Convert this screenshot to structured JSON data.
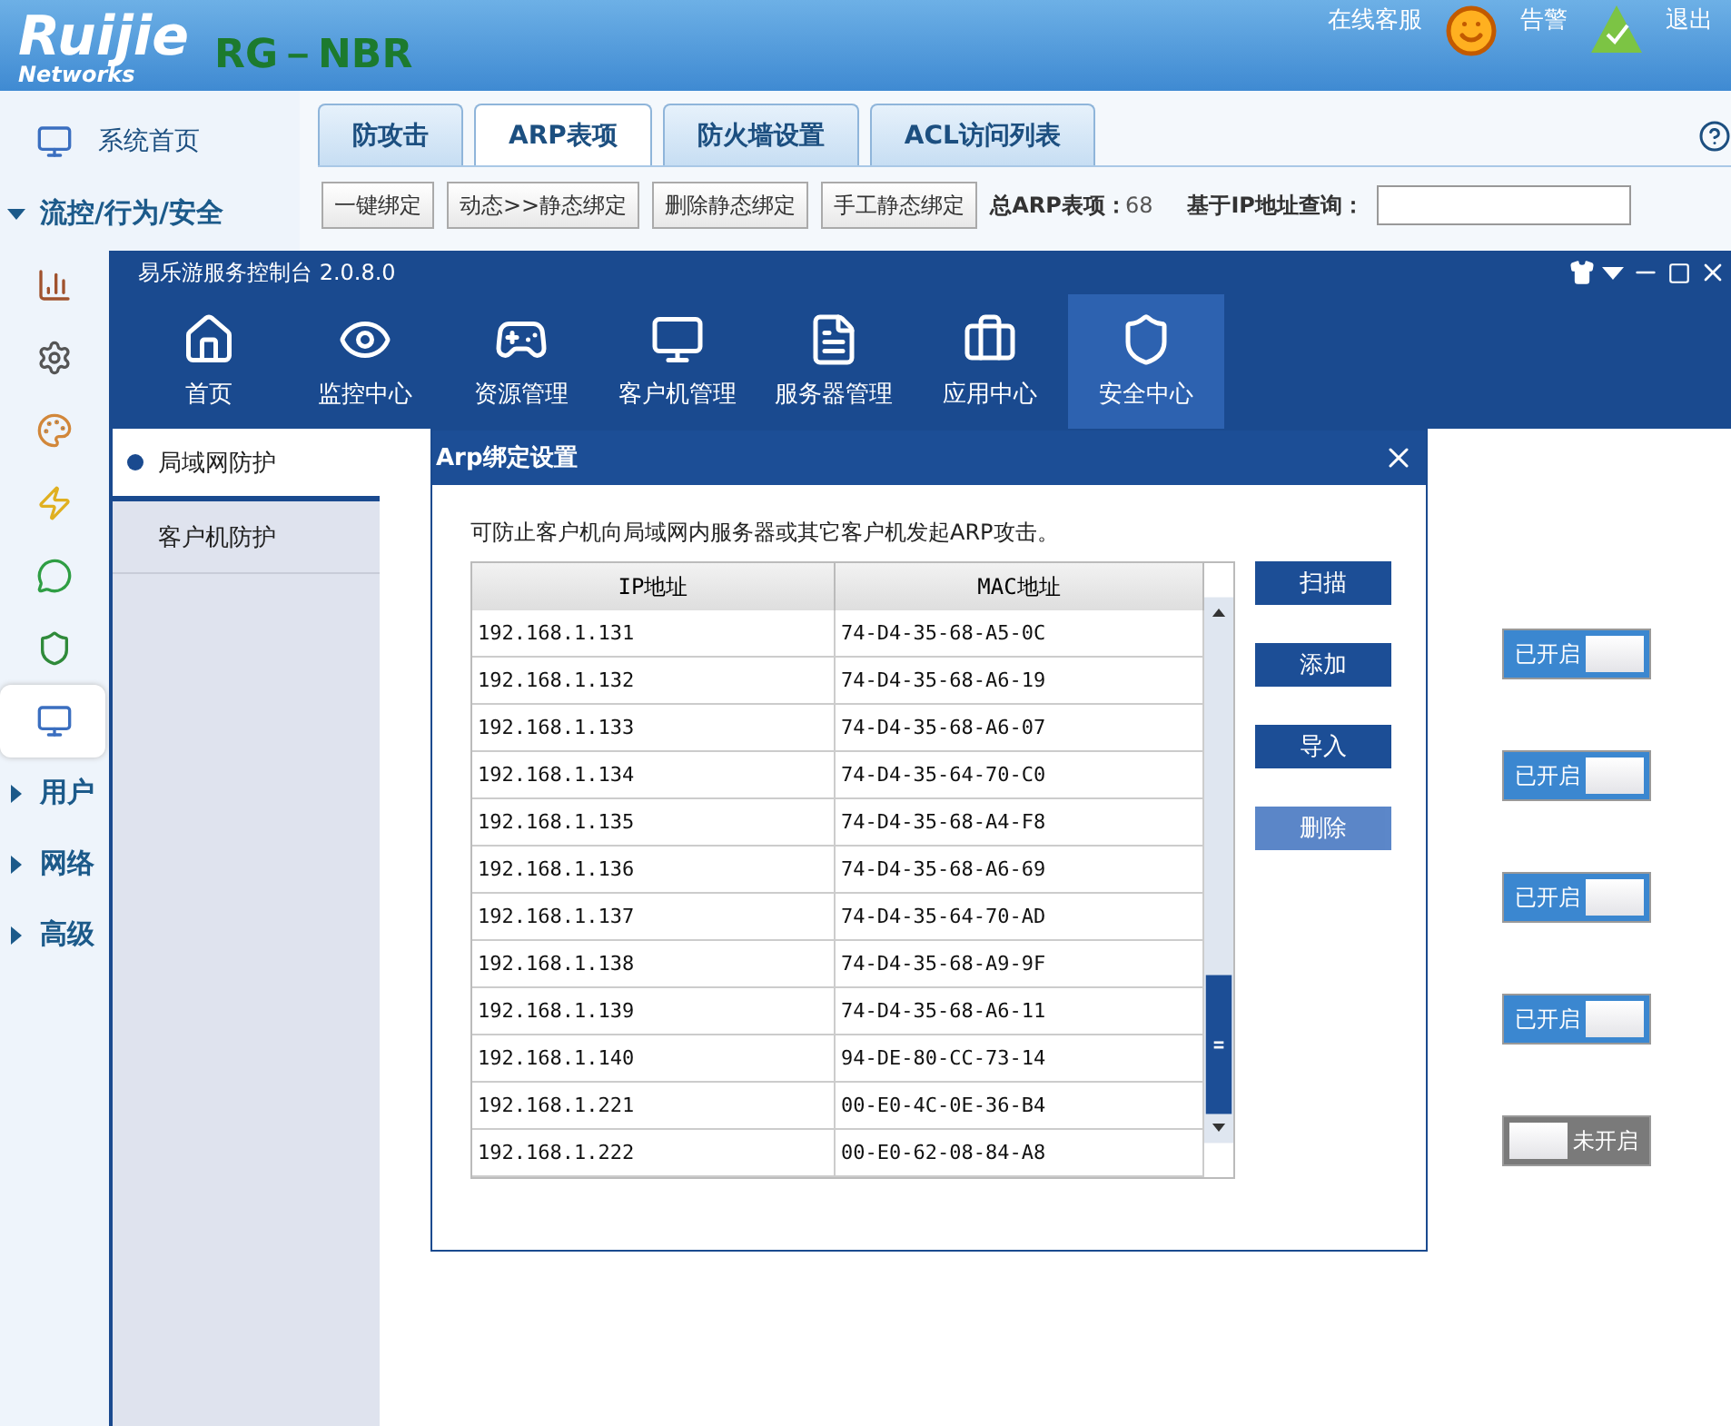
{
  "header": {
    "logo": "Ruijie",
    "logo_sub": "Networks",
    "product": "RG－NBR",
    "links": [
      {
        "label": "在线客服",
        "kind": "service"
      },
      {
        "label": "告警",
        "kind": "alarm"
      },
      {
        "label": "退出",
        "kind": "logout"
      }
    ]
  },
  "sidebar": {
    "items": [
      {
        "kind": "item",
        "label": "系统首页",
        "selected": false
      },
      {
        "kind": "section",
        "label": "流控/行为/安全",
        "expanded": true
      },
      {
        "kind": "item",
        "selected": false
      },
      {
        "kind": "item",
        "selected": false
      },
      {
        "kind": "item",
        "selected": false
      },
      {
        "kind": "item",
        "selected": false
      },
      {
        "kind": "item",
        "selected": false
      },
      {
        "kind": "item",
        "selected": false
      },
      {
        "kind": "item",
        "selected": true
      },
      {
        "kind": "section",
        "label": "用户",
        "expanded": false
      },
      {
        "kind": "section",
        "label": "网络",
        "expanded": false
      },
      {
        "kind": "section",
        "label": "高级",
        "expanded": false
      }
    ]
  },
  "tabs": [
    {
      "label": "防攻击",
      "selected": false
    },
    {
      "label": "ARP表项",
      "selected": true
    },
    {
      "label": "防火墙设置",
      "selected": false
    },
    {
      "label": "ACL访问列表",
      "selected": false
    }
  ],
  "toolbar": {
    "buttons": [
      "一键绑定",
      "动态>>静态绑定",
      "删除静态绑定",
      "手工静态绑定"
    ],
    "total_label": "总ARP表项：",
    "total": "68",
    "query_label": "基于IP地址查询："
  },
  "window": {
    "title": "易乐游服务控制台 2.0.8.0",
    "nav": [
      {
        "label": "首页",
        "selected": false
      },
      {
        "label": "监控中心",
        "selected": false
      },
      {
        "label": "资源管理",
        "selected": false
      },
      {
        "label": "客户机管理",
        "selected": false
      },
      {
        "label": "服务器管理",
        "selected": false
      },
      {
        "label": "应用中心",
        "selected": false
      },
      {
        "label": "安全中心",
        "selected": true
      }
    ],
    "side_items": [
      {
        "label": "局域网防护",
        "selected": true
      },
      {
        "label": "客户机防护",
        "selected": false
      }
    ],
    "toggles": [
      {
        "label": "已开启",
        "on": true
      },
      {
        "label": "已开启",
        "on": true
      },
      {
        "label": "已开启",
        "on": true
      },
      {
        "label": "已开启",
        "on": true
      },
      {
        "label": "未开启",
        "on": false
      }
    ]
  },
  "dialog": {
    "title": "Arp绑定设置",
    "description": "可防止客户机向局域网内服务器或其它客户机发起ARP攻击。",
    "columns": [
      "IP地址",
      "MAC地址"
    ],
    "rows": [
      [
        "192.168.1.131",
        "74-D4-35-68-A5-0C"
      ],
      [
        "192.168.1.132",
        "74-D4-35-68-A6-19"
      ],
      [
        "192.168.1.133",
        "74-D4-35-68-A6-07"
      ],
      [
        "192.168.1.134",
        "74-D4-35-64-70-C0"
      ],
      [
        "192.168.1.135",
        "74-D4-35-68-A4-F8"
      ],
      [
        "192.168.1.136",
        "74-D4-35-68-A6-69"
      ],
      [
        "192.168.1.137",
        "74-D4-35-64-70-AD"
      ],
      [
        "192.168.1.138",
        "74-D4-35-68-A9-9F"
      ],
      [
        "192.168.1.139",
        "74-D4-35-68-A6-11"
      ],
      [
        "192.168.1.140",
        "94-DE-80-CC-73-14"
      ],
      [
        "192.168.1.221",
        "00-E0-4C-0E-36-B4"
      ],
      [
        "192.168.1.222",
        "00-E0-62-08-84-A8"
      ]
    ],
    "buttons": [
      {
        "label": "扫描",
        "disabled": false
      },
      {
        "label": "添加",
        "disabled": false
      },
      {
        "label": "导入",
        "disabled": false
      },
      {
        "label": "删除",
        "disabled": true
      }
    ]
  }
}
